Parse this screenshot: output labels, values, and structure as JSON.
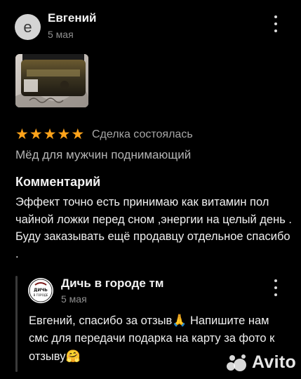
{
  "review": {
    "avatar_letter": "е",
    "author": "Евгений",
    "date": "5 мая",
    "rating": 5,
    "deal_status": "Сделка состоялась",
    "product": "Мёд для мужчин поднимающий",
    "comment_title": "Комментарий",
    "comment_text": "Эффект точно есть принимаю как витамин пол чайной ложки перед сном ,энергии на целый день . Буду заказывать ещё продавцу отдельное спасибо ."
  },
  "reply": {
    "author": "Дичь в городе тм",
    "date": "5 мая",
    "avatar_text": "ДИЧЬ В ГОРОДЕ",
    "text_part1": "Евгений, спасибо за отзыв",
    "emoji1": "🙏",
    "text_part2": " Напишите нам смс для передачи подарка на карту за фото к отзыву",
    "emoji2": "🤗"
  },
  "watermark": {
    "text": "Avito"
  },
  "colors": {
    "background": "#000000",
    "star": "#ffa31a",
    "secondary_text": "#a6a6a6",
    "date_text": "#8f8f8f"
  }
}
